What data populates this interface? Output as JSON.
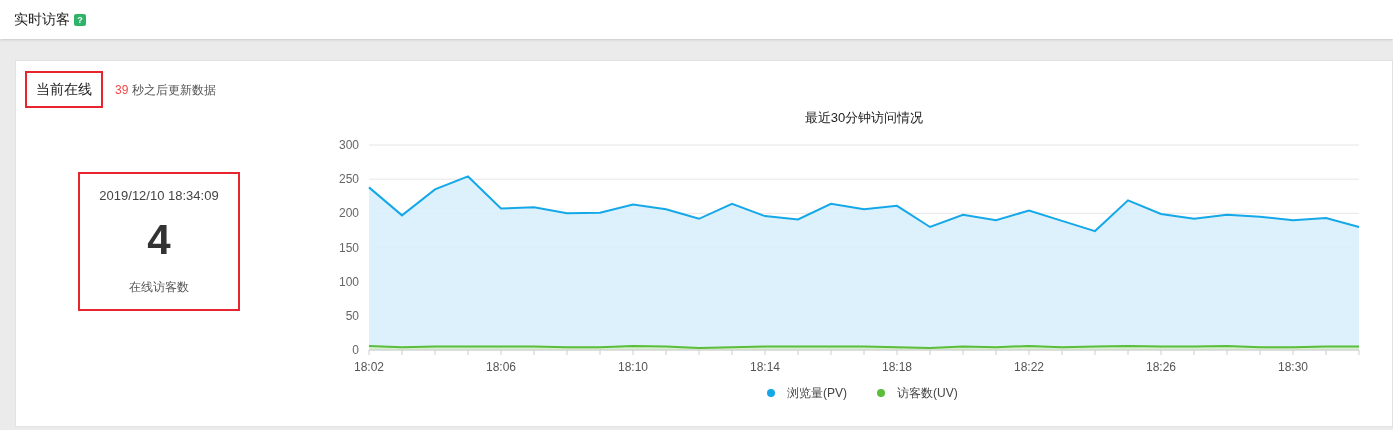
{
  "page": {
    "title": "实时访客",
    "help_icon": "?"
  },
  "card": {
    "title": "当前在线",
    "countdown": "39",
    "countdown_text": "秒之后更新数据"
  },
  "online": {
    "timestamp": "2019/12/10 18:34:09",
    "count": "4",
    "label": "在线访客数"
  },
  "chart_data": {
    "type": "area",
    "title": "最近30分钟访问情况",
    "legend": "bottom",
    "categories": [
      "18:02",
      null,
      null,
      null,
      "18:06",
      null,
      null,
      null,
      "18:10",
      null,
      null,
      null,
      "18:14",
      null,
      null,
      null,
      "18:18",
      null,
      null,
      null,
      "18:22",
      null,
      null,
      null,
      "18:26",
      null,
      null,
      null,
      "18:30",
      null,
      null
    ],
    "ylim": [
      0,
      300
    ],
    "yticks": [
      0,
      50,
      100,
      150,
      200,
      250,
      300
    ],
    "series": [
      {
        "name": "浏览量(PV)",
        "color": "#15a8e8",
        "values": [
          238,
          197,
          235,
          254,
          207,
          209,
          200,
          201,
          213,
          206,
          192,
          214,
          196,
          191,
          214,
          206,
          211,
          180,
          198,
          190,
          204,
          189,
          174,
          219,
          199,
          192,
          198,
          195,
          190,
          193,
          180
        ]
      },
      {
        "name": "访客数(UV)",
        "color": "#5bbd3a",
        "values": [
          6,
          4,
          5,
          5,
          5,
          5,
          4,
          4,
          6,
          5,
          3,
          4,
          5,
          5,
          5,
          5,
          4,
          3,
          5,
          4,
          6,
          4,
          5,
          6,
          5,
          5,
          6,
          4,
          4,
          5,
          5
        ]
      }
    ]
  }
}
